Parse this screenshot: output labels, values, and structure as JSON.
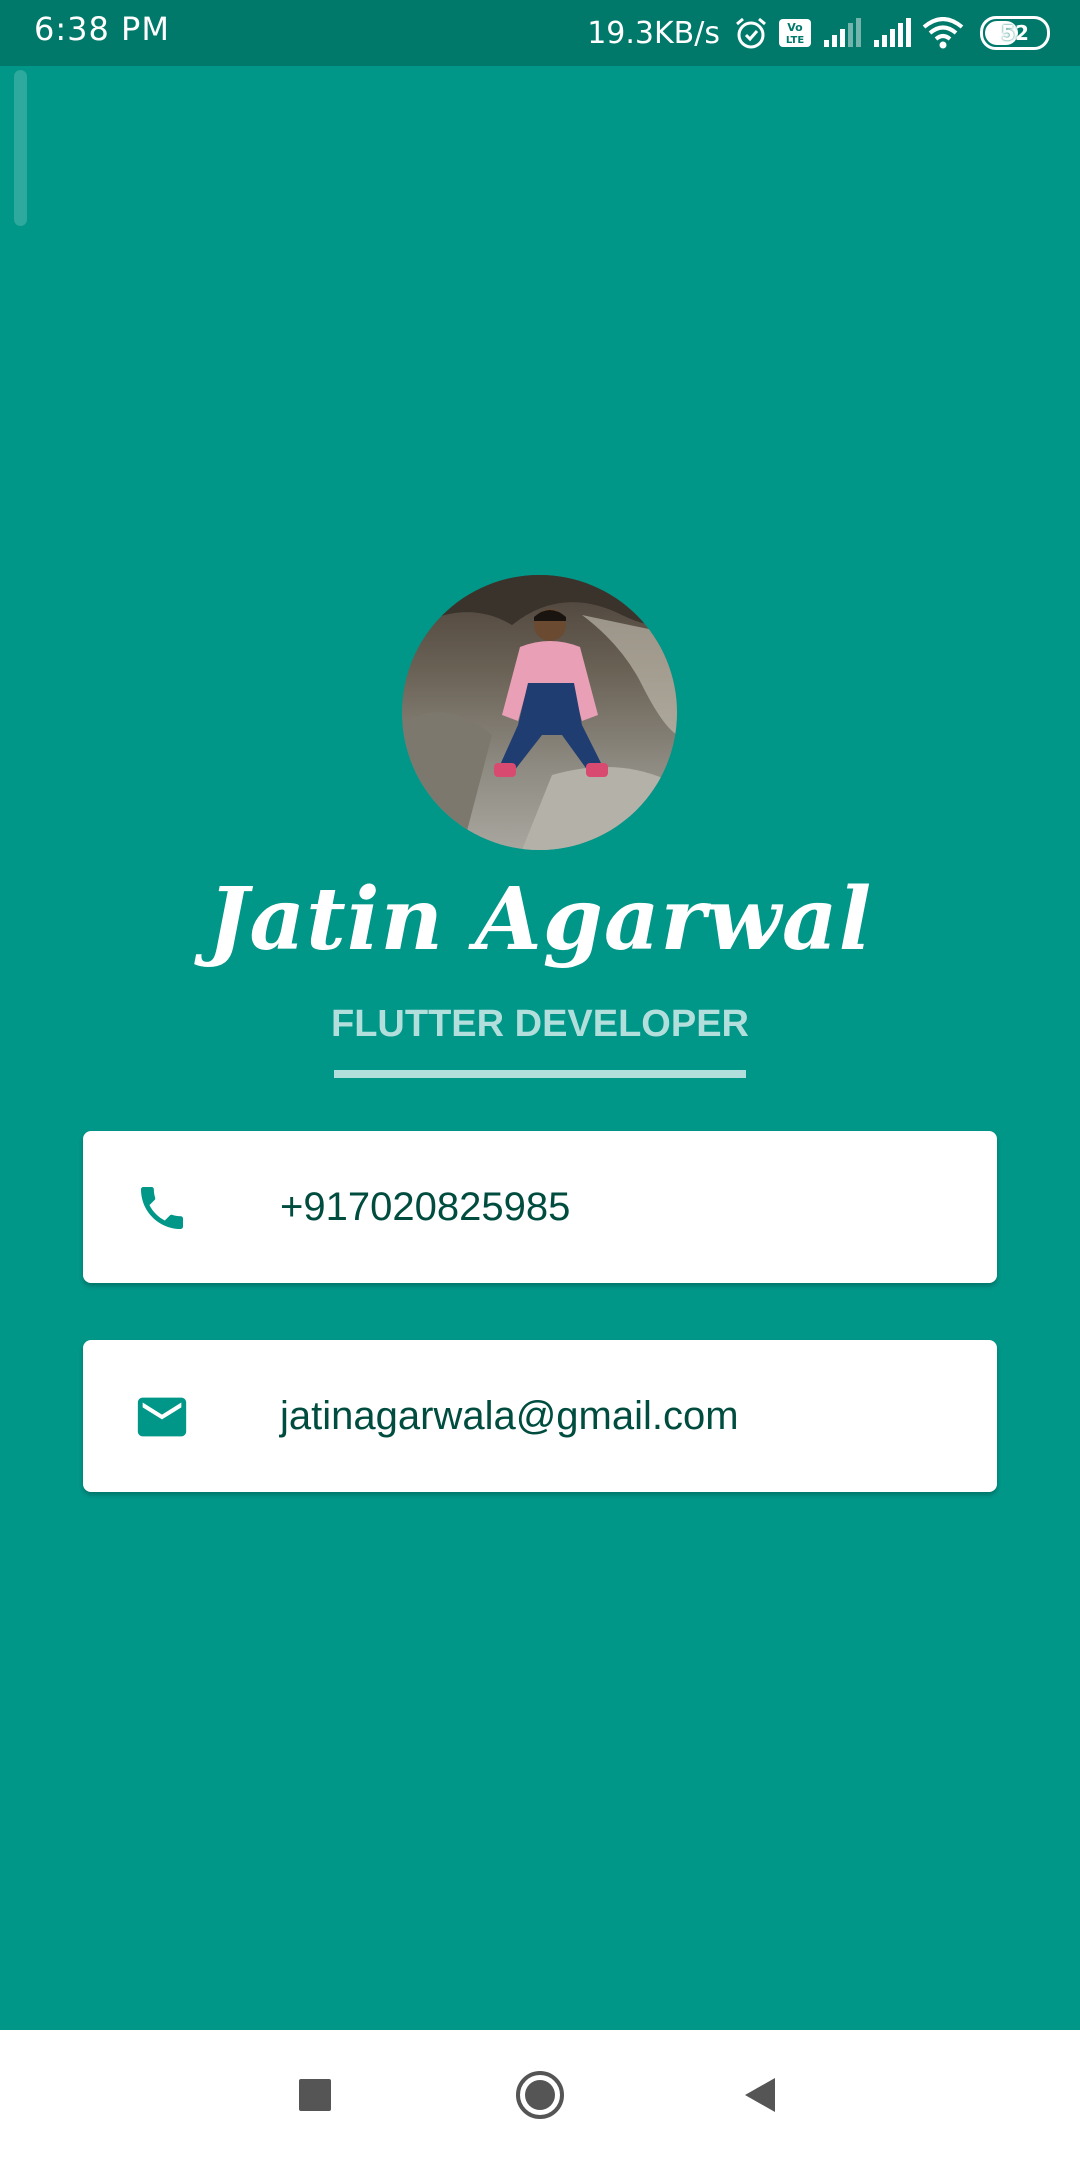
{
  "status_bar": {
    "time": "6:38 PM",
    "network_speed": "19.3KB/s",
    "battery_level": "52",
    "icons": [
      "alarm-icon",
      "volte-icon",
      "signal-icon",
      "signal-icon",
      "wifi-icon",
      "battery-icon"
    ]
  },
  "profile": {
    "avatar_icon": "profile-photo",
    "name": "Jatin Agarwal",
    "title": "FLUTTER DEVELOPER"
  },
  "contacts": {
    "phone": {
      "icon": "phone-icon",
      "value": "+917020825985"
    },
    "email": {
      "icon": "mail-icon",
      "value": "jatinagarwala@gmail.com"
    }
  },
  "nav_bar": {
    "icons": [
      "recents-icon",
      "home-icon",
      "back-icon"
    ]
  },
  "colors": {
    "background": "#009688",
    "status_bar": "#00796B",
    "subtitle": "#B2DFDB",
    "card": "#FFFFFF",
    "card_text": "#004D40",
    "icon": "#009688"
  }
}
